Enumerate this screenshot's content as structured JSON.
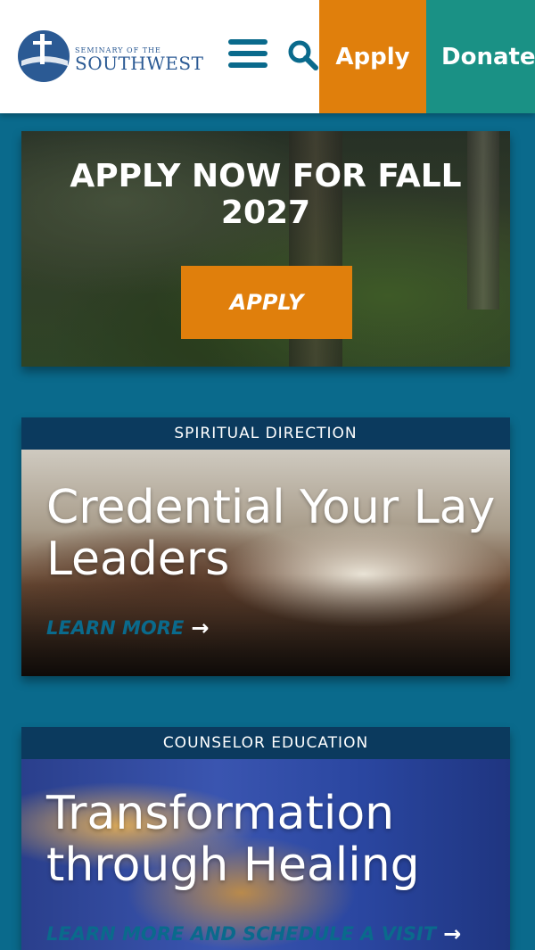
{
  "header": {
    "logo_small": "SEMINARY OF THE",
    "logo_big": "SOUTHWEST",
    "apply_label": "Apply",
    "donate_label": "Donate"
  },
  "hero": {
    "title": "APPLY NOW FOR FALL 2027",
    "button_label": "APPLY"
  },
  "cards": [
    {
      "label": "SPIRITUAL DIRECTION",
      "title": "Credential Your Lay Leaders",
      "link": "LEARN MORE"
    },
    {
      "label": "COUNSELOR EDUCATION",
      "title": "Transformation through Healing",
      "link": "LEARN MORE AND SCHEDULE A VISIT"
    }
  ],
  "colors": {
    "page_bg": "#0a6a8c",
    "apply": "#e07f0c",
    "donate": "#1a9185",
    "label_bar": "#0b3a5e"
  }
}
